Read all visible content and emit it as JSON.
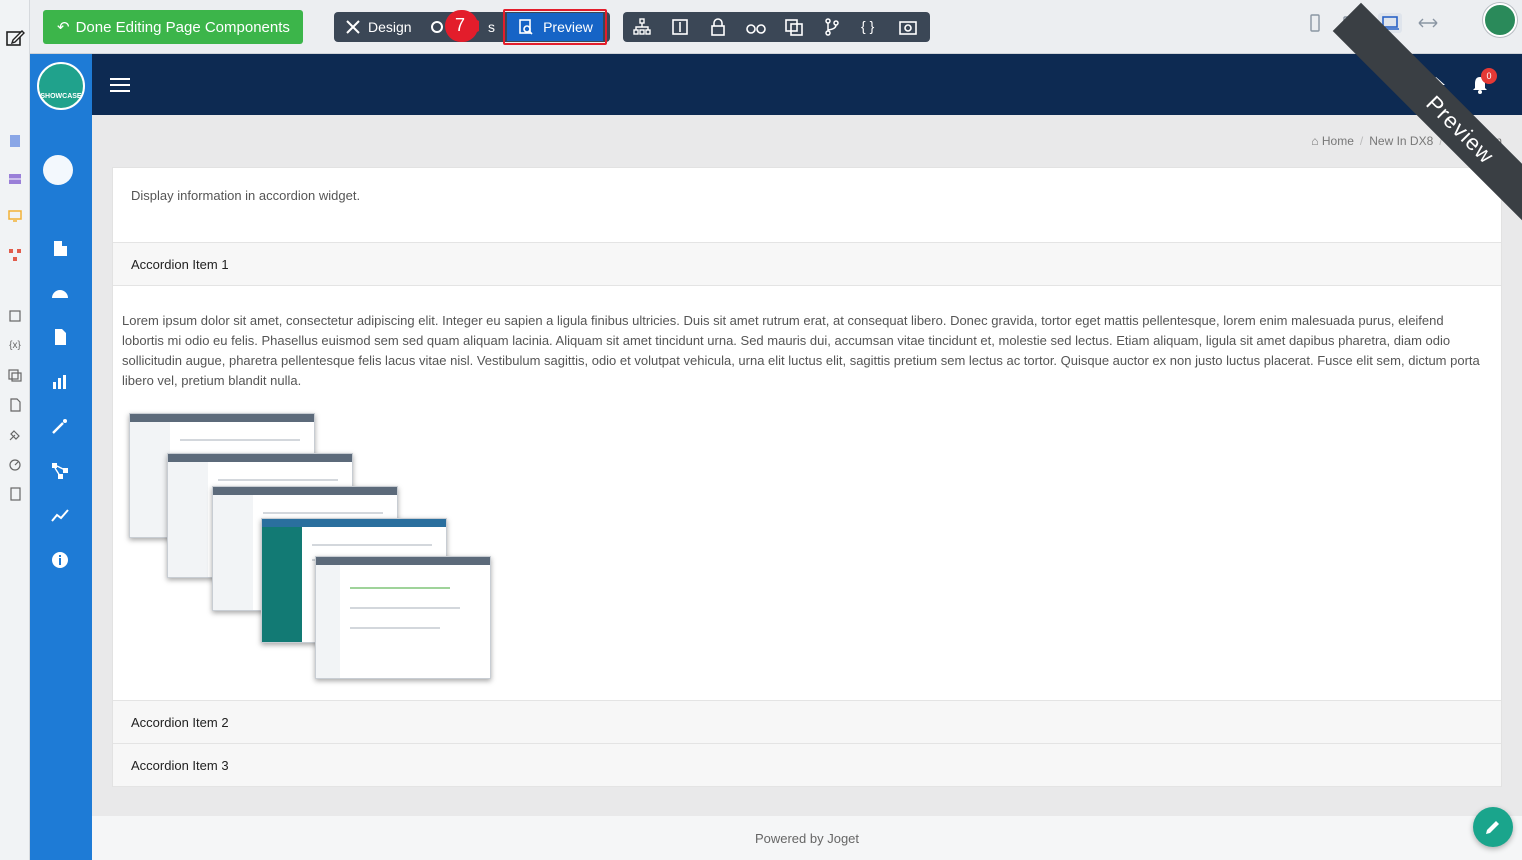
{
  "toolbar": {
    "done_label": "Done Editing Page Components",
    "design_label": "Design",
    "settings_label_partial": "s",
    "step_number": "7",
    "preview_label": "Preview"
  },
  "app": {
    "logo_text": "SHOWCASE",
    "notification_count": "0"
  },
  "breadcrumb": {
    "items": [
      "Home",
      "New In DX8",
      "Accordion"
    ]
  },
  "content": {
    "intro": "Display information in accordion widget.",
    "accordion": [
      {
        "title": "Accordion Item 1",
        "body": "Lorem ipsum dolor sit amet, consectetur adipiscing elit. Integer eu sapien a ligula finibus ultricies. Duis sit amet rutrum erat, at consequat libero. Donec gravida, tortor eget mattis pellentesque, lorem enim malesuada purus, eleifend lobortis mi odio eu felis. Phasellus euismod sem sed quam aliquam lacinia. Aliquam sit amet tincidunt urna. Sed mauris dui, accumsan vitae tincidunt et, molestie sed lectus. Etiam aliquam, ligula sit amet dapibus pharetra, diam odio sollicitudin augue, pharetra pellentesque felis lacus vitae nisl. Vestibulum sagittis, odio et volutpat vehicula, urna elit luctus elit, sagittis pretium sem lectus ac tortor. Quisque auctor ex non justo luctus placerat. Fusce elit sem, dictum porta libero vel, pretium blandit nulla."
      },
      {
        "title": "Accordion Item 2"
      },
      {
        "title": "Accordion Item 3"
      }
    ]
  },
  "footer": {
    "text": "Powered by Joget"
  },
  "ribbon": {
    "text": "Preview"
  },
  "colors": {
    "done_green": "#3cb54a",
    "preview_blue": "#1664c6",
    "header_navy": "#0d2a52",
    "sidebar_blue": "#1e7bd6",
    "step_red": "#e31d2b"
  }
}
